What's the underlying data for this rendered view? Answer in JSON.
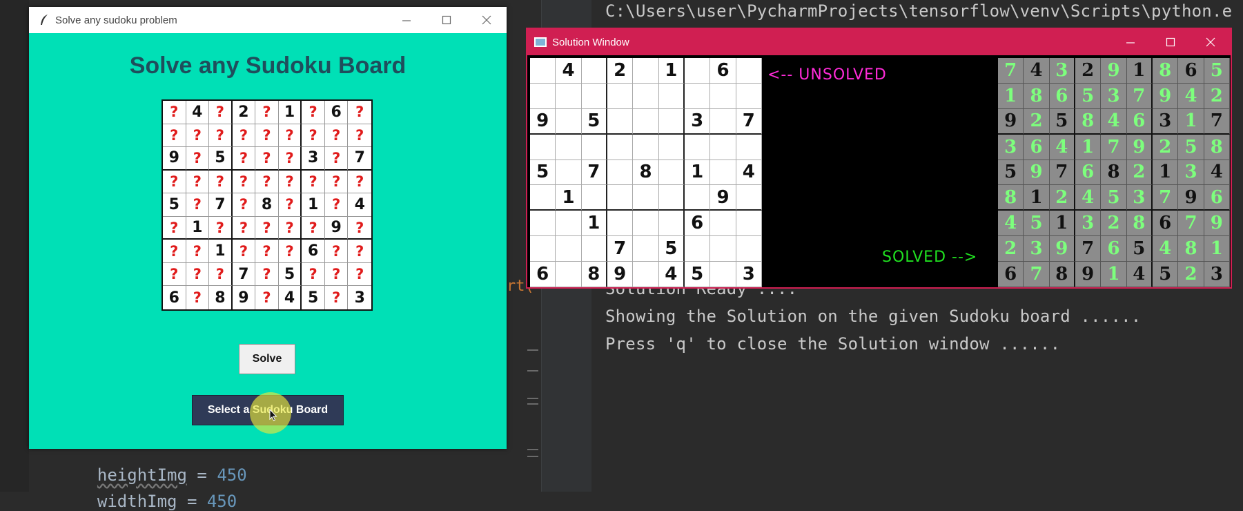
{
  "ide": {
    "terminal_lines": [
      "C:\\Users\\user\\PycharmProjects\\tensorflow\\venv\\Scripts\\python.e",
      "Solution Ready ....",
      "Showing the Solution on the given Sudoku board ......",
      "Press 'q' to close the Solution window ......"
    ],
    "code": {
      "height_name": "heightImg",
      "height_eq": " = ",
      "height_val": "450",
      "width_name": "widthImg",
      "width_eq": " = ",
      "width_val": "450",
      "fragment": "rt("
    }
  },
  "tk_window": {
    "title": "Solve any sudoku problem",
    "heading": "Solve any Sudoku Board",
    "solve_label": "Solve",
    "select_label": "Select a Sudoku Board",
    "board": [
      [
        "?",
        "4",
        "?",
        "2",
        "?",
        "1",
        "?",
        "6",
        "?"
      ],
      [
        "?",
        "?",
        "?",
        "?",
        "?",
        "?",
        "?",
        "?",
        "?"
      ],
      [
        "9",
        "?",
        "5",
        "?",
        "?",
        "?",
        "3",
        "?",
        "7"
      ],
      [
        "?",
        "?",
        "?",
        "?",
        "?",
        "?",
        "?",
        "?",
        "?"
      ],
      [
        "5",
        "?",
        "7",
        "?",
        "8",
        "?",
        "1",
        "?",
        "4"
      ],
      [
        "?",
        "1",
        "?",
        "?",
        "?",
        "?",
        "?",
        "9",
        "?"
      ],
      [
        "?",
        "?",
        "1",
        "?",
        "?",
        "?",
        "6",
        "?",
        "?"
      ],
      [
        "?",
        "?",
        "?",
        "7",
        "?",
        "5",
        "?",
        "?",
        "?"
      ],
      [
        "6",
        "?",
        "8",
        "9",
        "?",
        "4",
        "5",
        "?",
        "3"
      ]
    ]
  },
  "solution_window": {
    "title": "Solution Window",
    "unsolved_label": "<-- UNSOLVED",
    "solved_label": "SOLVED -->",
    "unsolved": [
      [
        "",
        "4",
        "",
        "2",
        "",
        "1",
        "",
        "6",
        ""
      ],
      [
        "",
        "",
        "",
        "",
        "",
        "",
        "",
        "",
        ""
      ],
      [
        "9",
        "",
        "5",
        "",
        "",
        "",
        "3",
        "",
        "7"
      ],
      [
        "",
        "",
        "",
        "",
        "",
        "",
        "",
        "",
        ""
      ],
      [
        "5",
        "",
        "7",
        "",
        "8",
        "",
        "1",
        "",
        "4"
      ],
      [
        "",
        "1",
        "",
        "",
        "",
        "",
        "",
        "9",
        ""
      ],
      [
        "",
        "",
        "1",
        "",
        "",
        "",
        "6",
        "",
        ""
      ],
      [
        "",
        "",
        "",
        "7",
        "",
        "5",
        "",
        "",
        ""
      ],
      [
        "6",
        "",
        "8",
        "9",
        "",
        "4",
        "5",
        "",
        "3"
      ]
    ],
    "solved": [
      [
        "7",
        "4",
        "3",
        "2",
        "9",
        "1",
        "8",
        "6",
        "5"
      ],
      [
        "1",
        "8",
        "6",
        "5",
        "3",
        "7",
        "9",
        "4",
        "2"
      ],
      [
        "9",
        "2",
        "5",
        "8",
        "4",
        "6",
        "3",
        "1",
        "7"
      ],
      [
        "3",
        "6",
        "4",
        "1",
        "7",
        "9",
        "2",
        "5",
        "8"
      ],
      [
        "5",
        "9",
        "7",
        "6",
        "8",
        "2",
        "1",
        "3",
        "4"
      ],
      [
        "8",
        "1",
        "2",
        "4",
        "5",
        "3",
        "7",
        "9",
        "6"
      ],
      [
        "4",
        "5",
        "1",
        "3",
        "2",
        "8",
        "6",
        "7",
        "9"
      ],
      [
        "2",
        "3",
        "9",
        "7",
        "6",
        "5",
        "4",
        "8",
        "1"
      ],
      [
        "6",
        "7",
        "8",
        "9",
        "1",
        "4",
        "5",
        "2",
        "3"
      ]
    ]
  },
  "colors": {
    "tk_bg": "#00e0b6",
    "heading": "#1f4e5c",
    "question_mark": "#e01b1b",
    "unsolved_label": "#ff2bd9",
    "solved_label": "#20e020",
    "solved_digit": "#7dff7d",
    "solution_titlebar": "#d01f52"
  }
}
